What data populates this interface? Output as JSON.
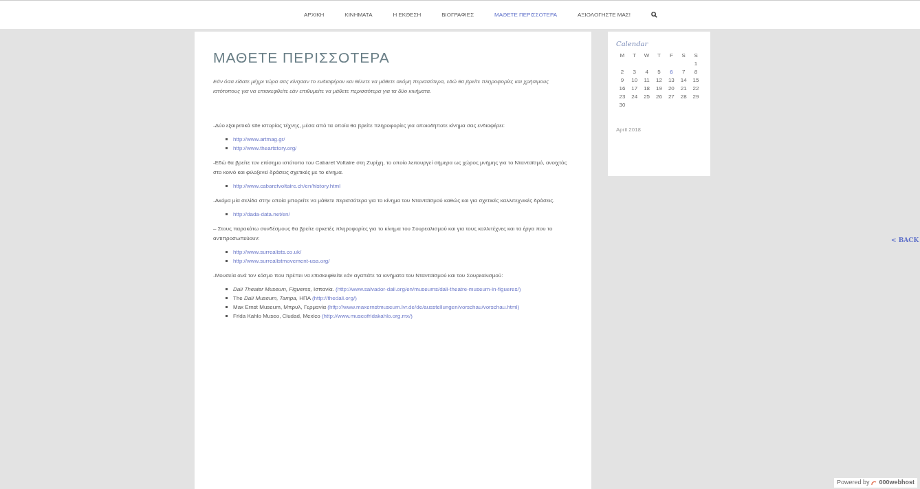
{
  "nav": {
    "items": [
      {
        "label": "ΑΡΧΙΚΗ",
        "selected": false
      },
      {
        "label": "ΚΙΝΗΜΑΤΑ",
        "selected": false
      },
      {
        "label": "Η ΕΚΘΕΣΗ",
        "selected": false
      },
      {
        "label": "ΒΙΟΓΡΑΦΙΕΣ",
        "selected": false
      },
      {
        "label": "ΜΑΘΕΤΕ ΠΕΡΙΣΣΟΤΕΡΑ",
        "selected": true
      },
      {
        "label": "ΑΞΙΟΛΟΓΗΣΤΕ ΜΑΣ!",
        "selected": false
      }
    ]
  },
  "article": {
    "title": "ΜΑΘΕΤΕ ΠΕΡΙΣΣΟΤΕΡΑ",
    "intro": "Εάν όσα είδατε μέχρι τώρα σας κίνησαν το ενδιαφέρον και θέλετε να μάθετε ακόμη περισσότερα, εδώ θα βρείτε πληροφορίες και χρήσιμους ιστότοπους για να επισκεφθείτε εάν επιθυμείτε να μάθετε περισσότερα για τα δύο κινήματα.",
    "sections": [
      {
        "text": "-Δύο εξαιρετικά site ιστορίας τέχνης, μέσα από τα οποία θα βρείτε πληροφορίες για οποιοδήποτε κίνημα σας ενδιαφέρει:",
        "items": [
          {
            "link": "http://www.artmag.gr/"
          },
          {
            "link": "http://www.theartstory.org/"
          }
        ]
      },
      {
        "text": "-Εδώ θα βρείτε τον επίσημο ιστότοπο του Cabaret Voltaire στη Ζυρίχη, το οποίο λειτουργεί σήμερα ως χώρος μνήμης για το Ντανταϊσμό, ανοιχτός στο κοινό και φιλοξενεί δράσεις σχετικές με το κίνημα.",
        "items": [
          {
            "link": "http://www.cabaretvoltaire.ch/en/history.html"
          }
        ]
      },
      {
        "text": "-Ακόμα μία σελίδα στην οποία μπορείτε να μάθετε περισσότερα για το κίνημα του Ντανταϊσμού καθώς και για σχετικές καλλιτεχνικές δράσεις.",
        "items": [
          {
            "link": "http://dada-data.net/en/"
          }
        ]
      },
      {
        "text": "– Στους παρακάτω συνδέσμους θα βρείτε αρκετές πληροφορίες για το κίνημα του Σουρεαλισμού και για τους καλλιτέχνες και τα έργα που το αντιπροσωπεύουν:",
        "items": [
          {
            "link": "http://www.surrealists.co.uk/"
          },
          {
            "link": "http://www.surrealistmovement-usa.org/"
          }
        ]
      },
      {
        "text": "-Μουσεία ανά τον κόσμο που πρέπει να επισκεφθείτε εάν αγαπάτε τα κινήματα του Ντανταϊσμού και του Σουρεαλισμού:",
        "items": [
          {
            "label": "*Dalí Theater Museum, Figueres,* Ισπανία.",
            "link": "(http://www.salvador-dali.org/en/museums/dali-theatre-museum-in-figueres/)"
          },
          {
            "label": "The *Dalí Museum, Tampa,* ΗΠΑ",
            "link": "(http://thedali.org/)"
          },
          {
            "label": "Max Ernst Museum, Μπρυλ, Γερμανία",
            "link": "(http://www.maxernstmuseum.lvr.de/de/ausstellungen/vorschau/vorschau.html)"
          },
          {
            "label": "Frida Kahlo Museo, Ciudad, Mexico",
            "link": "(http://www.museofridakahlo.org.mx/)"
          }
        ]
      }
    ]
  },
  "calendar": {
    "title": "Calendar",
    "weekdays": [
      "M",
      "T",
      "W",
      "T",
      "F",
      "S",
      "S"
    ],
    "weeks": [
      [
        {
          "day": "1",
          "selected": false
        }
      ],
      [
        {
          "day": "2",
          "selected": false
        },
        {
          "day": "3",
          "selected": false
        },
        {
          "day": "4",
          "selected": false
        },
        {
          "day": "5",
          "selected": false
        },
        {
          "day": "6",
          "selected": true
        },
        {
          "day": "7",
          "selected": false
        },
        {
          "day": "8",
          "selected": false
        }
      ],
      [
        {
          "day": "9",
          "selected": false
        },
        {
          "day": "10",
          "selected": false
        },
        {
          "day": "11",
          "selected": false
        },
        {
          "day": "12",
          "selected": false
        },
        {
          "day": "13",
          "selected": false
        },
        {
          "day": "14",
          "selected": false
        },
        {
          "day": "15",
          "selected": false
        }
      ],
      [
        {
          "day": "16",
          "selected": false
        },
        {
          "day": "17",
          "selected": false
        },
        {
          "day": "18",
          "selected": false
        },
        {
          "day": "19",
          "selected": false
        },
        {
          "day": "20",
          "selected": false
        },
        {
          "day": "21",
          "selected": false
        },
        {
          "day": "22",
          "selected": false
        }
      ],
      [
        {
          "day": "23",
          "selected": false
        },
        {
          "day": "24",
          "selected": false
        },
        {
          "day": "25",
          "selected": false
        },
        {
          "day": "26",
          "selected": false
        },
        {
          "day": "27",
          "selected": false
        },
        {
          "day": "28",
          "selected": false
        },
        {
          "day": "29",
          "selected": false
        }
      ],
      [
        {
          "day": "30",
          "selected": false
        }
      ]
    ],
    "footer": "April 2018"
  },
  "back_link": "< BACK",
  "badge": {
    "prefix": "Powered by",
    "brand": "000webhost"
  }
}
